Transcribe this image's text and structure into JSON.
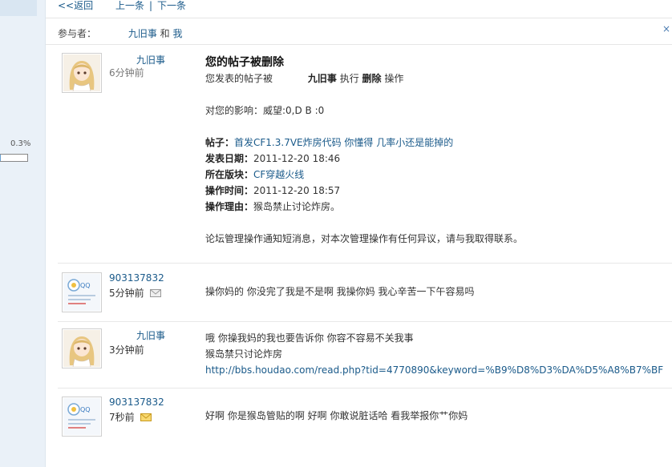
{
  "leftbar": {
    "percent_label": "0.3%",
    "progress_fraction": 0.003
  },
  "nav": {
    "back": "<<返回",
    "prev": "上一条",
    "separator": "|",
    "next": "下一条"
  },
  "participants": {
    "label": "参与者：",
    "user1": "九旧事",
    "and": "和",
    "user2": "我"
  },
  "close_label": "×",
  "messages": [
    {
      "user": "九旧事",
      "time": "6分钟前",
      "title": "您的帖子被删除",
      "line1_prefix": "您发表的帖子被",
      "line1_user": "九旧事",
      "line1_exec": "执行",
      "line1_action": "删除",
      "line1_suffix": "操作",
      "impact": "对您的影响：威望:0,D B :0",
      "post_label": "帖子：",
      "post_title": "首发CF1.3.7VE炸房代码  你懂得    几率小还是能掉的",
      "date_label": "发表日期：",
      "date_value": "2011-12-20 18:46",
      "board_label": "所在版块：",
      "board_value": "CF穿越火线",
      "optime_label": "操作时间：",
      "optime_value": "2011-12-20 18:57",
      "reason_label": "操作理由：",
      "reason_value": "猴岛禁止讨论炸房。",
      "notice": "论坛管理操作通知短消息，对本次管理操作有任何异议，请与我取得联系。"
    },
    {
      "user": "903137832",
      "time": "5分钟前",
      "text": "操你妈的   你没完了我是不是啊   我操你妈    我心辛苦一下午容易吗"
    },
    {
      "user": "九旧事",
      "time": "3分钟前",
      "line1": "哦  你操我妈的我也要告诉你  你容不容易不关我事",
      "line2": "猴岛禁只讨论炸房",
      "link": "http://bbs.houdao.com/read.php?tid=4770890&keyword=%B9%D8%D3%DA%D5%A8%B7%BF"
    },
    {
      "user": "903137832",
      "time": "7秒前",
      "text": "好啊      你是猴岛管贴的啊      好啊      你敢说脏话哈      看我举报你艹你妈"
    }
  ]
}
